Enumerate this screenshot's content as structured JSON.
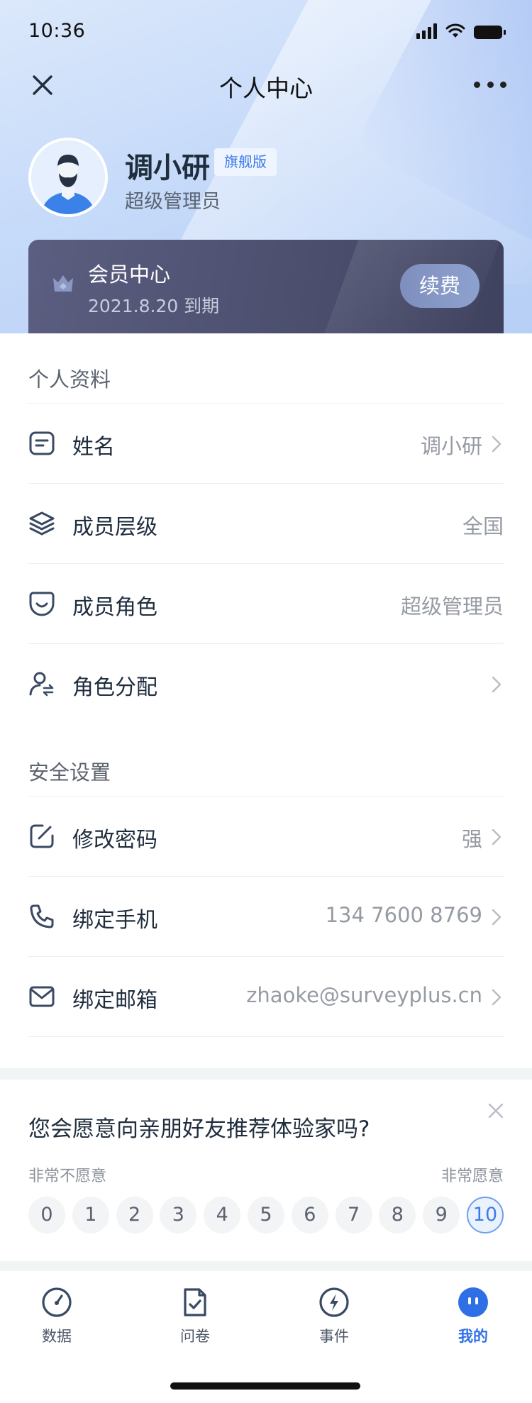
{
  "status_bar": {
    "time": "10:36"
  },
  "nav": {
    "title": "个人中心"
  },
  "profile": {
    "name": "调小研",
    "badge": "旗舰版",
    "role": "超级管理员"
  },
  "membership": {
    "title": "会员中心",
    "expire": "2021.8.20 到期",
    "renew_label": "续费"
  },
  "personal": {
    "section_title": "个人资料",
    "rows": [
      {
        "label": "姓名",
        "value": "调小研",
        "icon": "name-card-icon"
      },
      {
        "label": "成员层级",
        "value": "全国",
        "icon": "layers-icon"
      },
      {
        "label": "成员角色",
        "value": "超级管理员",
        "icon": "smile-icon"
      },
      {
        "label": "角色分配",
        "value": "",
        "icon": "user-switch-icon"
      }
    ]
  },
  "security": {
    "section_title": "安全设置",
    "rows": [
      {
        "label": "修改密码",
        "value": "强",
        "icon": "edit-icon"
      },
      {
        "label": "绑定手机",
        "value": "134 7600 8769",
        "icon": "phone-icon"
      },
      {
        "label": "绑定邮箱",
        "value": "zhaoke@surveyplus.cn",
        "icon": "mail-icon"
      }
    ]
  },
  "survey": {
    "question": "您会愿意向亲朋好友推荐体验家吗?",
    "min_label": "非常不愿意",
    "max_label": "非常愿意",
    "scores": [
      "0",
      "1",
      "2",
      "3",
      "4",
      "5",
      "6",
      "7",
      "8",
      "9",
      "10"
    ],
    "selected": "10"
  },
  "tabbar": {
    "tabs": [
      {
        "label": "数据",
        "icon": "gauge-icon"
      },
      {
        "label": "问卷",
        "icon": "document-check-icon"
      },
      {
        "label": "事件",
        "icon": "bolt-icon"
      },
      {
        "label": "我的",
        "icon": "profile-icon"
      }
    ],
    "active": "我的"
  },
  "colors": {
    "accent": "#2f6fe6",
    "card": "#4b4e6d",
    "text": "#1f2d3d",
    "muted": "#969ba3"
  }
}
